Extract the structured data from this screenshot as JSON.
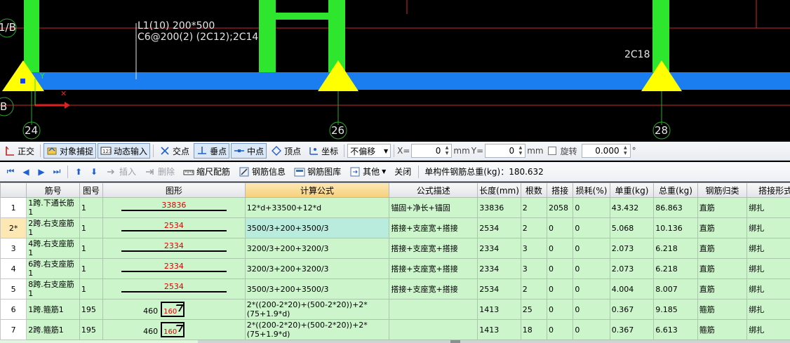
{
  "cad": {
    "beam_label_line1": "L1(10) 200*500",
    "beam_label_line2": "C6@200(2) (2C12);2C14",
    "bar_label": "2C18",
    "axis_left_top": "1/B",
    "axis_left_bottom": "B",
    "axis_bottom": [
      "24",
      "26",
      "28"
    ],
    "colors": {
      "column": "#2ee62e",
      "beam": "#1a7df0",
      "support": "#ffff00",
      "grid": "#e03030"
    }
  },
  "snapbar": {
    "items": [
      {
        "label": "正交",
        "icon": "ortho-icon",
        "active": false
      },
      {
        "label": "对象捕捉",
        "icon": "object-snap-icon",
        "active": true
      },
      {
        "label": "动态输入",
        "icon": "dynamic-input-icon",
        "active": true
      },
      {
        "label": "交点",
        "icon": "intersection-icon",
        "active": false
      },
      {
        "label": "垂点",
        "icon": "perpendicular-icon",
        "active": true
      },
      {
        "label": "中点",
        "icon": "midpoint-icon",
        "active": true
      },
      {
        "label": "顶点",
        "icon": "vertex-icon",
        "active": false
      },
      {
        "label": "坐标",
        "icon": "coordinate-icon",
        "active": false
      }
    ],
    "offset_select": "不偏移",
    "x_label": "X=",
    "x_value": "0",
    "y_label": "Y=",
    "y_value": "0",
    "unit": "mm",
    "rotate_label": "旋转",
    "rotate_value": "0.000",
    "degree": "°"
  },
  "editbar": {
    "insert": "插入",
    "delete": "删除",
    "scale_bar": "缩尺配筋",
    "rebar_info": "钢筋信息",
    "rebar_library": "钢筋图库",
    "other": "其他",
    "close": "关闭",
    "total": "单构件钢筋总重(kg)：180.632"
  },
  "grid": {
    "headers": [
      "",
      "筋号",
      "图号",
      "图形",
      "计算公式",
      "公式描述",
      "长度(mm)",
      "根数",
      "搭接",
      "损耗(%)",
      "单重(kg)",
      "总重(kg)",
      "钢筋归类",
      "搭接形式"
    ],
    "rows": [
      {
        "num": "1",
        "name": "1跨.下通长筋1",
        "fig": "1",
        "shape": "line",
        "shape_value": "33836",
        "formula": "12*d+33500+12*d",
        "desc": "锚固+净长+锚固",
        "length": "33836",
        "count": "2",
        "lap": "2058",
        "loss": "0",
        "unit_w": "43.432",
        "total_w": "86.863",
        "category": "直筋",
        "lap_type": "绑扎"
      },
      {
        "num": "2*",
        "name": "2跨.右支座筋1",
        "fig": "1",
        "shape": "line",
        "shape_value": "2534",
        "formula": "3500/3+200+3500/3",
        "desc": "搭接+支座宽+搭接",
        "length": "2534",
        "count": "2",
        "lap": "0",
        "loss": "0",
        "unit_w": "5.068",
        "total_w": "10.136",
        "category": "直筋",
        "lap_type": "绑扎"
      },
      {
        "num": "3",
        "name": "4跨.右支座筋1",
        "fig": "1",
        "shape": "line",
        "shape_value": "2334",
        "formula": "3200/3+200+3200/3",
        "desc": "搭接+支座宽+搭接",
        "length": "2334",
        "count": "3",
        "lap": "0",
        "loss": "0",
        "unit_w": "2.073",
        "total_w": "6.218",
        "category": "直筋",
        "lap_type": "绑扎"
      },
      {
        "num": "4",
        "name": "6跨.右支座筋1",
        "fig": "1",
        "shape": "line",
        "shape_value": "2334",
        "formula": "3200/3+200+3200/3",
        "desc": "搭接+支座宽+搭接",
        "length": "2334",
        "count": "3",
        "lap": "0",
        "loss": "0",
        "unit_w": "2.073",
        "total_w": "6.218",
        "category": "直筋",
        "lap_type": "绑扎"
      },
      {
        "num": "5",
        "name": "8跨.右支座筋1",
        "fig": "1",
        "shape": "line",
        "shape_value": "2534",
        "formula": "3500/3+200+3500/3",
        "desc": "搭接+支座宽+搭接",
        "length": "2534",
        "count": "2",
        "lap": "0",
        "loss": "0",
        "unit_w": "4.004",
        "total_w": "8.007",
        "category": "直筋",
        "lap_type": "绑扎"
      },
      {
        "num": "6",
        "name": "1跨.箍筋1",
        "fig": "195",
        "shape": "stirrup",
        "shape_left": "460",
        "shape_value": "160",
        "formula": "2*((200-2*20)+(500-2*20))+2*(75+1.9*d)",
        "desc": "",
        "length": "1413",
        "count": "25",
        "lap": "0",
        "loss": "0",
        "unit_w": "0.367",
        "total_w": "9.185",
        "category": "箍筋",
        "lap_type": "绑扎"
      },
      {
        "num": "7",
        "name": "2跨.箍筋1",
        "fig": "195",
        "shape": "stirrup",
        "shape_left": "460",
        "shape_value": "160",
        "formula": "2*((200-2*20)+(500-2*20))+2*(75+1.9*d)",
        "desc": "",
        "length": "1413",
        "count": "18",
        "lap": "0",
        "loss": "0",
        "unit_w": "0.367",
        "total_w": "6.613",
        "category": "箍筋",
        "lap_type": "绑扎"
      }
    ]
  }
}
